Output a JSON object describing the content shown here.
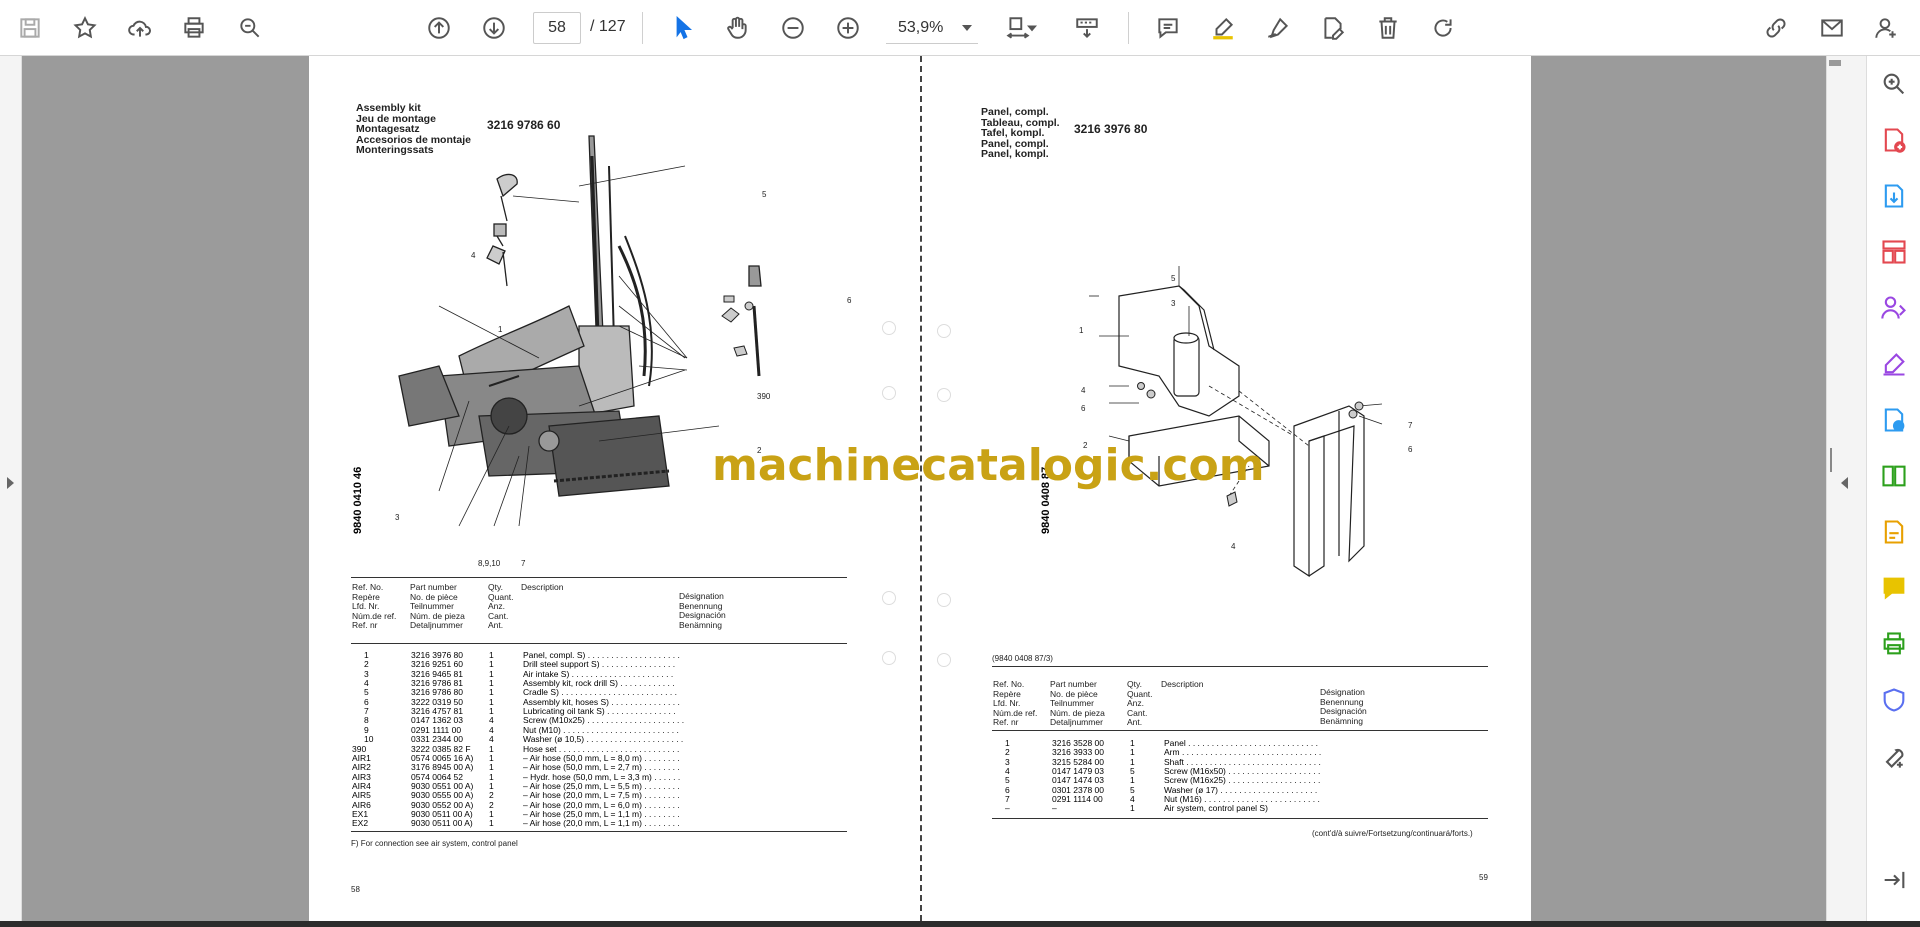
{
  "toolbar": {
    "page_current": "58",
    "page_total": "/ 127",
    "zoom": "53,9%",
    "icons": [
      "save-icon",
      "star-icon",
      "upload-icon",
      "print-icon",
      "search-icon",
      "page-up-icon",
      "page-down-icon",
      "select-cursor-icon",
      "hand-icon",
      "zoom-out-icon",
      "zoom-in-icon",
      "fit-page-icon",
      "scroll-mode-icon",
      "comment-icon",
      "highlight-pen-icon",
      "draw-icon",
      "edit-text-icon",
      "delete-icon",
      "rotate-icon",
      "share-link-icon",
      "email-icon",
      "account-icon"
    ]
  },
  "left_page": {
    "titles": [
      "Assembly kit",
      "Jeu de montage",
      "Montagesatz",
      "Accesorios de montaje",
      "Monteringssats"
    ],
    "part_code": "3216 9786 60",
    "vertical_code": "9840 0410 46",
    "callouts": [
      "5",
      "4",
      "6",
      "1",
      "390",
      "2",
      "3",
      "8,9,10",
      "7"
    ],
    "header_col1": [
      "Ref. No.",
      "Repère",
      "Lfd. Nr.",
      "Núm.de ref.",
      "Ref. nr"
    ],
    "header_col2": [
      "Part number",
      "No. de pièce",
      "Teilnummer",
      "Núm. de pieza",
      "Detaljnummer"
    ],
    "header_col3": [
      "Qty.",
      "Quant.",
      "Anz.",
      "Cant.",
      "Ant."
    ],
    "header_col4": [
      "Description"
    ],
    "header_col5": [
      "Désignation",
      "Benennung",
      "Designación",
      "Benämning"
    ],
    "rows": [
      {
        "ref": "1",
        "part": "3216 3976 80",
        "qty": "1",
        "desc": "Panel, compl. S) . . . . . . . . . . . . . . . . . . . ."
      },
      {
        "ref": "2",
        "part": "3216 9251 60",
        "qty": "1",
        "desc": "Drill steel support S) . . . . . . . . . . . . . . . ."
      },
      {
        "ref": "3",
        "part": "3216 9465 81",
        "qty": "1",
        "desc": "Air intake S) . . . . . . . . . . . . . . . . . . . . . ."
      },
      {
        "ref": "4",
        "part": "3216 9786 81",
        "qty": "1",
        "desc": "Assembly kit, rock drill S) . . . . . . . . . . . ."
      },
      {
        "ref": "5",
        "part": "3216 9786 80",
        "qty": "1",
        "desc": "Cradle S) . . . . . . . . . . . . . . . . . . . . . . . . ."
      },
      {
        "ref": "6",
        "part": "3222 0319 50",
        "qty": "1",
        "desc": "Assembly kit, hoses S) . . . . . . . . . . . . . . ."
      },
      {
        "ref": "7",
        "part": "3216 4757 81",
        "qty": "1",
        "desc": "Lubricating oil tank S) . . . . . . . . . . . . . . ."
      },
      {
        "ref": "8",
        "part": "0147 1362 03",
        "qty": "4",
        "desc": "Screw (M10x25) . . . . . . . . . . . . . . . . . . . . ."
      },
      {
        "ref": "9",
        "part": "0291 1111 00",
        "qty": "4",
        "desc": "Nut (M10) . . . . . . . . . . . . . . . . . . . . . . . . ."
      },
      {
        "ref": "10",
        "part": "0331 2344 00",
        "qty": "4",
        "desc": "Washer (ø 10,5) . . . . . . . . . . . . . . . . . . . . ."
      },
      {
        "ref": "390",
        "part": "3222 0385 82 F",
        "qty": "1",
        "desc": "Hose set . . . . . . . . . . . . . . . . . . . . . . . . . ."
      },
      {
        "ref": "AIR1",
        "part": "0574 0065 16 A)",
        "qty": "1",
        "desc": "– Air hose (50,0 mm, L = 8,0 m) . . . . . . . ."
      },
      {
        "ref": "AIR2",
        "part": "3176 8945 00 A)",
        "qty": "1",
        "desc": "– Air hose (50,0 mm, L = 2,7 m) . . . . . . . ."
      },
      {
        "ref": "AIR3",
        "part": "0574 0064 52",
        "qty": "1",
        "desc": "– Hydr. hose (50,0 mm, L = 3,3 m) . . . . . ."
      },
      {
        "ref": "AIR4",
        "part": "9030 0551 00 A)",
        "qty": "1",
        "desc": "– Air hose (25,0 mm, L = 5,5 m) . . . . . . . ."
      },
      {
        "ref": "AIR5",
        "part": "9030 0555 00 A)",
        "qty": "2",
        "desc": "– Air hose (20,0 mm, L = 7,5 m) . . . . . . . ."
      },
      {
        "ref": "AIR6",
        "part": "9030 0552 00 A)",
        "qty": "2",
        "desc": "– Air hose (20,0 mm, L = 6,0 m) . . . . . . . ."
      },
      {
        "ref": "EX1",
        "part": "9030 0511 00 A)",
        "qty": "1",
        "desc": "– Air hose (25,0 mm, L = 1,1 m) . . . . . . . ."
      },
      {
        "ref": "EX2",
        "part": "9030 0511 00 A)",
        "qty": "1",
        "desc": "– Air hose (20,0 mm, L = 1,1 m) . . . . . . . ."
      }
    ],
    "footnote": "F) For connection see air system, control panel",
    "page_number": "58"
  },
  "right_page": {
    "titles": [
      "Panel, compl.",
      "Tableau, compl.",
      "Tafel, kompl.",
      "Panel, compl.",
      "Panel, kompl."
    ],
    "part_code": "3216 3976 80",
    "vertical_code": "9840 0408 87",
    "callouts": [
      "5",
      "3",
      "1",
      "4",
      "6",
      "2",
      "7",
      "6",
      "4"
    ],
    "ref_note": "(9840 0408 87/3)",
    "header_col1": [
      "Ref. No.",
      "Repère",
      "Lfd. Nr.",
      "Núm.de ref.",
      "Ref. nr"
    ],
    "header_col2": [
      "Part number",
      "No. de pièce",
      "Teilnummer",
      "Núm. de pieza",
      "Detaljnummer"
    ],
    "header_col3": [
      "Qty.",
      "Quant.",
      "Anz.",
      "Cant.",
      "Ant."
    ],
    "header_col4": [
      "Description"
    ],
    "header_col5": [
      "Désignation",
      "Benennung",
      "Designación",
      "Benämning"
    ],
    "rows": [
      {
        "ref": "1",
        "part": "3216 3528 00",
        "qty": "1",
        "desc": "Panel . . . . . . . . . . . . . . . . . . . . . . . . . . . ."
      },
      {
        "ref": "2",
        "part": "3216 3933 00",
        "qty": "1",
        "desc": "Arm . . . . . . . . . . . . . . . . . . . . . . . . . . . . . ."
      },
      {
        "ref": "3",
        "part": "3215 5284 00",
        "qty": "1",
        "desc": "Shaft . . . . . . . . . . . . . . . . . . . . . . . . . . . . ."
      },
      {
        "ref": "4",
        "part": "0147 1479 03",
        "qty": "5",
        "desc": "Screw (M16x50) . . . . . . . . . . . . . . . . . . . ."
      },
      {
        "ref": "5",
        "part": "0147 1474 03",
        "qty": "1",
        "desc": "Screw (M16x25) . . . . . . . . . . . . . . . . . . . ."
      },
      {
        "ref": "6",
        "part": "0301 2378 00",
        "qty": "5",
        "desc": "Washer (ø 17) . . . . . . . . . . . . . . . . . . . . ."
      },
      {
        "ref": "7",
        "part": "0291 1114 00",
        "qty": "4",
        "desc": "Nut (M16) . . . . . . . . . . . . . . . . . . . . . . . . ."
      },
      {
        "ref": "–",
        "part": "–",
        "qty": "1",
        "desc": "Air system, control panel S)"
      }
    ],
    "continued": "(cont'd/à suivre/Fortsetzung/continuará/forts.)",
    "page_number": "59"
  },
  "watermark": "machinecatalogic.com",
  "right_panel_icons": [
    "zoom-icon",
    "create-pdf-icon",
    "export-pdf-icon",
    "organize-pages-icon",
    "share-icon",
    "fill-sign-icon",
    "send-for-review-icon",
    "compare-icon",
    "edit-pdf-icon",
    "comment-panel-icon",
    "print-production-icon",
    "protect-icon",
    "more-tools-icon",
    "collapse-panel-icon"
  ]
}
